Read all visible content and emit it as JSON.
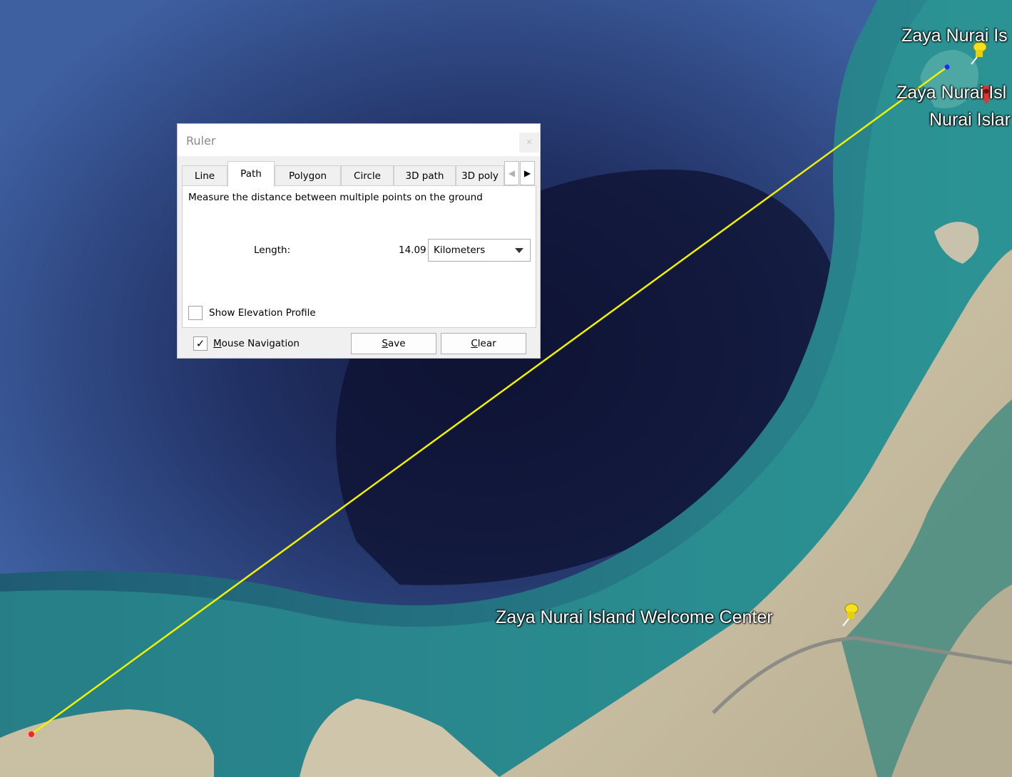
{
  "map": {
    "labels": {
      "top_island": "Zaya Nurai Is",
      "island_poi": "Zaya Nurai Isl",
      "island_sub": "Nurai Islar",
      "welcome_center": "Zaya Nurai Island Welcome Center"
    }
  },
  "ruler": {
    "title": "Ruler",
    "close_icon": "close-icon",
    "tabs": [
      "Line",
      "Path",
      "Polygon",
      "Circle",
      "3D path",
      "3D poly"
    ],
    "active_tab": "Path",
    "description": "Measure the distance between multiple points on the ground",
    "length_label": "Length:",
    "length_value": "14.09",
    "unit": "Kilometers",
    "show_elevation_label": "Show Elevation Profile",
    "show_elevation_checked": false,
    "mouse_nav_label": "Mouse Navigation",
    "mouse_nav_checked": true,
    "save_label": "Save",
    "clear_label": "Clear",
    "save_prefix": "S",
    "save_rest": "ave",
    "clear_prefix": "C",
    "clear_rest": "lear",
    "mouse_prefix": "M",
    "mouse_rest": "ouse Navigation"
  },
  "colors": {
    "measure_line": "#f2f200",
    "start_point": "#ff2020",
    "end_point": "#1a2cff",
    "pin_yellow": "#f5e21a"
  }
}
